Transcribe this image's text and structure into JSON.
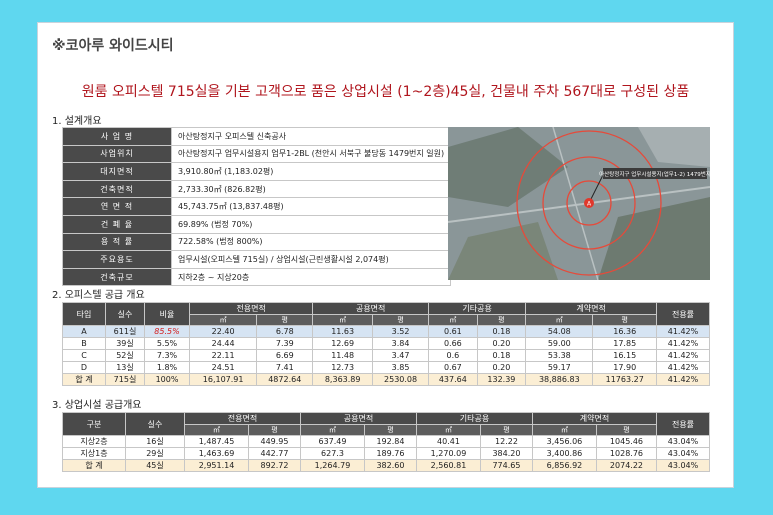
{
  "brand": "※코아루 와이드시티",
  "headline": "원룸 오피스텔 715실을 기본 고객으로 품은 상업시설 (1~2층)45실, 건물내 주차 567대로 구성된 상품",
  "sections": {
    "design": "1. 설계개요",
    "officetel": "2. 오피스텔 공급 개요",
    "commercial": "3. 상업시설 공급개요"
  },
  "spec": [
    {
      "k": "사 업 명",
      "v": "아산탕정지구 오피스텔 신축공사"
    },
    {
      "k": "사업위치",
      "v": "아산탕정지구 업무시설용지 업무1-2BL (천안시 서북구 불당동 1479번지 일원)"
    },
    {
      "k": "대지면적",
      "v": "3,910.80㎡ (1,183.02평)"
    },
    {
      "k": "건축면적",
      "v": "2,733.30㎡ (826.82평)"
    },
    {
      "k": "연 면 적",
      "v": "45,743.75㎡ (13,837.48평)"
    },
    {
      "k": "건 폐 율",
      "v": "69.89% (법정 70%)"
    },
    {
      "k": "용 적 률",
      "v": "722.58% (법정 800%)"
    },
    {
      "k": "주요용도",
      "v": "업무시설(오피스텔 715실) / 상업시설(근린생활시설 2,074평)"
    },
    {
      "k": "건축규모",
      "v": "지하2층 ~ 지상20층"
    }
  ],
  "map": {
    "label": "아산탕정지구 업무시설용지(업무1-2) 1479번지",
    "marker": "A"
  },
  "officetel": {
    "headers": {
      "type": "타입",
      "units": "실수",
      "ratio": "비율",
      "exclusive": "전용면적",
      "common": "공용면적",
      "other": "기타공용",
      "contract": "계약면적",
      "rate": "전용률",
      "sqm": "㎡",
      "py": "평"
    },
    "rows": [
      [
        "A",
        "611실",
        "85.5%",
        "22.40",
        "6.78",
        "11.63",
        "3.52",
        "0.61",
        "0.18",
        "54.08",
        "16.36",
        "41.42%"
      ],
      [
        "B",
        "39실",
        "5.5%",
        "24.44",
        "7.39",
        "12.69",
        "3.84",
        "0.66",
        "0.20",
        "59.00",
        "17.85",
        "41.42%"
      ],
      [
        "C",
        "52실",
        "7.3%",
        "22.11",
        "6.69",
        "11.48",
        "3.47",
        "0.6",
        "0.18",
        "53.38",
        "16.15",
        "41.42%"
      ],
      [
        "D",
        "13실",
        "1.8%",
        "24.51",
        "7.41",
        "12.73",
        "3.85",
        "0.67",
        "0.20",
        "59.17",
        "17.90",
        "41.42%"
      ]
    ],
    "total": [
      "합 계",
      "715실",
      "100%",
      "16,107.91",
      "4872.64",
      "8,363.89",
      "2530.08",
      "437.64",
      "132.39",
      "38,886.83",
      "11763.27",
      "41.42%"
    ]
  },
  "commercial": {
    "headers": {
      "type": "구분",
      "units": "실수",
      "exclusive": "전용면적",
      "common": "공용면적",
      "other": "기타공용",
      "contract": "계약면적",
      "rate": "전용률",
      "sqm": "㎡",
      "py": "평"
    },
    "rows": [
      [
        "지상2층",
        "16실",
        "1,487.45",
        "449.95",
        "637.49",
        "192.84",
        "40.41",
        "12.22",
        "3,456.06",
        "1045.46",
        "43.04%"
      ],
      [
        "지상1층",
        "29실",
        "1,463.69",
        "442.77",
        "627.3",
        "189.76",
        "1,270.09",
        "384.20",
        "3,400.86",
        "1028.76",
        "43.04%"
      ]
    ],
    "total": [
      "합 계",
      "45실",
      "2,951.14",
      "892.72",
      "1,264.79",
      "382.60",
      "2,560.81",
      "774.65",
      "6,856.92",
      "2074.22",
      "43.04%"
    ]
  },
  "colors": {
    "background": "#5fd7ef",
    "headline": "#b0151d",
    "header": "#4a4a4a",
    "highlight": "#d21a1a",
    "total_row": "#fbeed4",
    "selected_row": "#d6e4f3"
  }
}
